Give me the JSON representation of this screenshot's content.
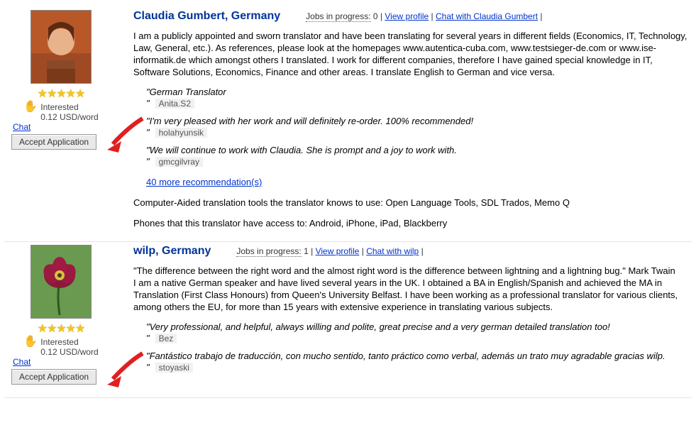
{
  "applicants": [
    {
      "name": "Claudia Gumbert, Germany",
      "jobs_label": "Jobs in progress",
      "jobs_count": "0",
      "view_profile": "View profile",
      "chat_with": "Chat with Claudia Gumbert",
      "interested": "Interested",
      "rate": "0.12 USD/word",
      "chat": "Chat",
      "accept": "Accept Application",
      "bio": "I am a publicly appointed and sworn translator and have been translating for several years in different fields (Economics, IT, Technology, Law, General, etc.). As references, please look at the homepages www.autentica-cuba.com, www.testsieger-de.com or www.ise-informatik.de which amongst others I translated. I work for different companies, therefore I have gained special knowledge in IT, Software Solutions, Economics, Finance and other areas. I translate English to German and vice versa.",
      "testimonials": [
        {
          "text": "\"German Translator",
          "author": "Anita.S2"
        },
        {
          "text": "\"I'm very pleased with her work and will definitely re-order. 100% recommended!",
          "author": "holahyunsik"
        },
        {
          "text": "\"We will continue to work with Claudia. She is prompt and a joy to work with.",
          "author": "gmcgilvray"
        }
      ],
      "more": "40 more recommendation(s)",
      "tools": "Computer-Aided translation tools the translator knows to use: Open Language Tools, SDL Trados, Memo Q",
      "phones": "Phones that this translator have access to: Android, iPhone, iPad, Blackberry"
    },
    {
      "name": "wilp, Germany",
      "jobs_label": "Jobs in progress",
      "jobs_count": "1",
      "view_profile": "View profile",
      "chat_with": "Chat with wilp",
      "interested": "Interested",
      "rate": "0.12 USD/word",
      "chat": "Chat",
      "accept": "Accept Application",
      "bio": "\"The difference between the right word and the almost right word is the difference between lightning and a lightning bug.\" Mark Twain\nI am a native German speaker and have lived several years in the UK. I obtained a BA in English/Spanish and achieved the MA in Translation (First Class Honours) from Queen's University Belfast. I have been working as a professional translator for various clients, among others the EU, for more than 15 years with extensive experience in translating various subjects.",
      "testimonials": [
        {
          "text": "\"Very professional, and helpful, always willing and polite, great precise and a very german detailed translation too!",
          "author": "Bez"
        },
        {
          "text": "\"Fantástico trabajo de traducción, con mucho sentido, tanto práctico como verbal, además un trato muy agradable gracias wilp.",
          "author": "stoyaski"
        }
      ]
    }
  ]
}
